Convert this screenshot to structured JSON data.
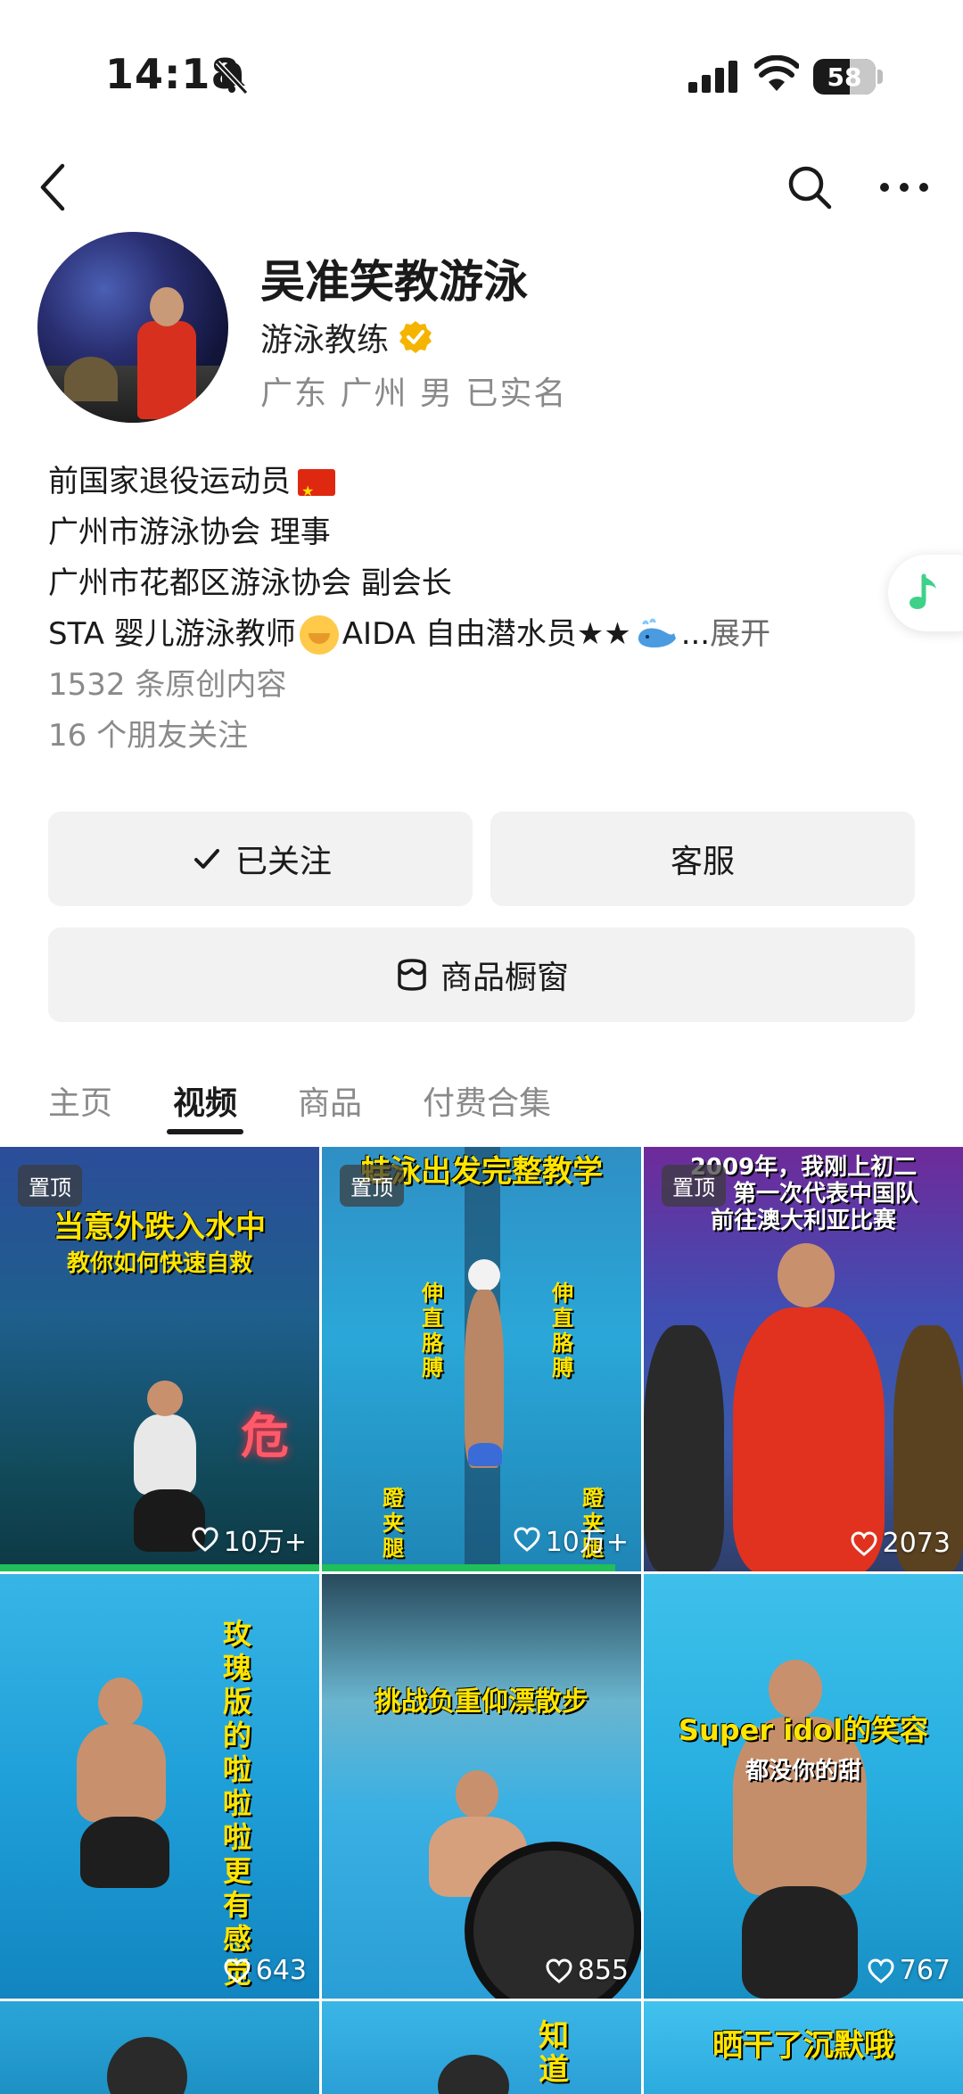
{
  "status": {
    "time": "14:18",
    "battery": "58",
    "battery_level": 0.58
  },
  "nav": {
    "back_icon": "chevron-left-icon",
    "search_icon": "search-icon",
    "more_icon": "more-dots-icon"
  },
  "profile": {
    "name": "吴准笑教游泳",
    "title": "游泳教练",
    "meta": "广东 广州 男 已实名",
    "bio": [
      "前国家退役运动员",
      "广州市游泳协会 理事",
      "广州市花都区游泳协会 副会长"
    ],
    "bio_line4_a": "STA 婴儿游泳教师",
    "bio_line4_b": "AIDA 自由潜水员★★",
    "bio_line4_c": "...",
    "expand": "展开",
    "stats": "1532 条原创内容",
    "friends": "16 个朋友关注"
  },
  "buttons": {
    "follow": "已关注",
    "service": "客服",
    "store": "商品橱窗"
  },
  "tabs": [
    {
      "label": "主页"
    },
    {
      "label": "视频"
    },
    {
      "label": "商品"
    },
    {
      "label": "付费合集"
    }
  ],
  "videos": [
    {
      "pin": "置顶",
      "caption1": "当意外跌入水中",
      "caption2": "教你如何快速自救",
      "mark": "危",
      "likes": "10万+",
      "progress": 1.0
    },
    {
      "pin": "置顶",
      "caption1": "蛙泳出发完整教学",
      "v1": "伸直胳膊",
      "v2": "伸直胳膊",
      "v3": "蹬夹腿",
      "v4": "蹬夹腿",
      "likes": "10万+",
      "progress": 0.92
    },
    {
      "pin": "置顶",
      "caption1": "2009年，我刚上初二",
      "caption2": "第一次代表中国队",
      "caption3": "前往澳大利亚比赛",
      "likes": "2073"
    },
    {
      "caption1": "玫瑰版的啦啦啦更有感觉",
      "likes": "643"
    },
    {
      "caption1": "挑战负重仰漂散步",
      "likes": "855"
    },
    {
      "caption1": "Super idol的笑容",
      "caption2": "都没你的甜",
      "likes": "767"
    },
    {},
    {
      "caption1": "知道"
    },
    {
      "caption1": "晒干了沉默哦"
    }
  ]
}
